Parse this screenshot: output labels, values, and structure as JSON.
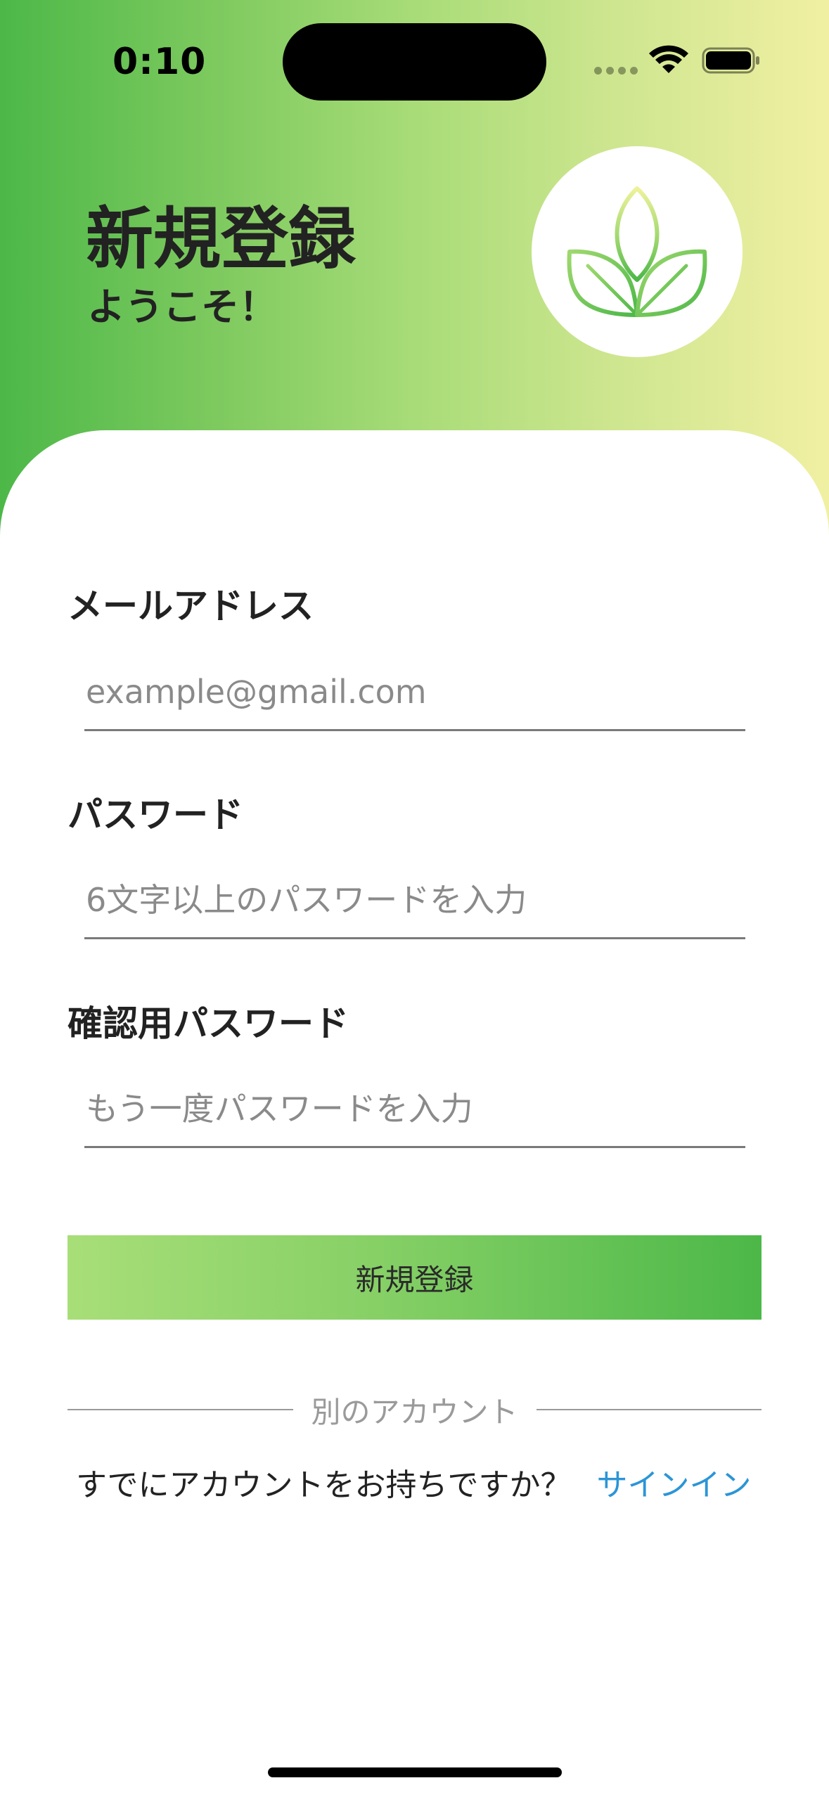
{
  "status_bar": {
    "time": "0:10",
    "wifi_icon": "wifi-icon",
    "battery_icon": "battery-full-icon"
  },
  "header": {
    "title": "新規登録",
    "subtitle": "ようこそ！",
    "logo_icon": "leaf-sprout-icon"
  },
  "form": {
    "email": {
      "label": "メールアドレス",
      "value": "",
      "placeholder": "example@gmail.com"
    },
    "password": {
      "label": "パスワード",
      "value": "",
      "placeholder": "6文字以上のパスワードを入力"
    },
    "confirm_password": {
      "label": "確認用パスワード",
      "value": "",
      "placeholder": "もう一度パスワードを入力"
    },
    "submit_label": "新規登録"
  },
  "alternate": {
    "divider_label": "別のアカウント",
    "prompt": "すでにアカウントをお持ちですか？",
    "signin_link": "サインイン"
  },
  "colors": {
    "gradient_start": "#4cb848",
    "gradient_end": "#f1f0a2",
    "link": "#2b95d6"
  }
}
